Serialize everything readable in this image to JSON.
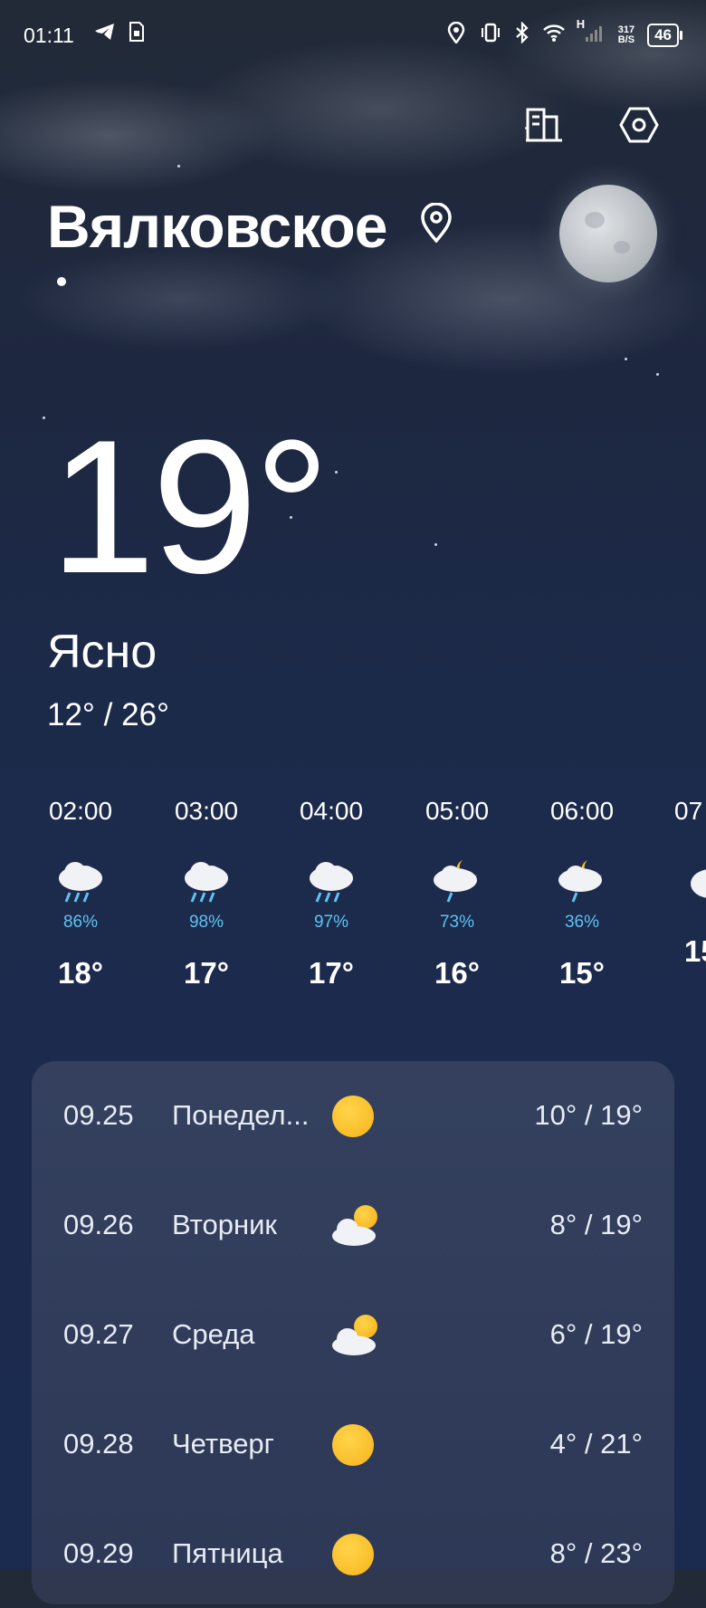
{
  "status_bar": {
    "time": "01:11",
    "net_speed_top": "317",
    "net_speed_bottom": "B/S",
    "network_label": "H",
    "battery": "46"
  },
  "location": {
    "city": "Вялковское",
    "current_temp": "19°",
    "condition": "Ясно",
    "range": "12° / 26°"
  },
  "hourly": [
    {
      "time": "02:00",
      "icon": "rain-cloud-icon",
      "precip": "86%",
      "temp": "18°"
    },
    {
      "time": "03:00",
      "icon": "rain-cloud-icon",
      "precip": "98%",
      "temp": "17°"
    },
    {
      "time": "04:00",
      "icon": "rain-cloud-icon",
      "precip": "97%",
      "temp": "17°"
    },
    {
      "time": "05:00",
      "icon": "moon-rain-cloud-icon",
      "precip": "73%",
      "temp": "16°"
    },
    {
      "time": "06:00",
      "icon": "moon-rain-cloud-icon",
      "precip": "36%",
      "temp": "15°"
    },
    {
      "time": "07",
      "icon": "cloud-icon",
      "precip": "",
      "temp": "15"
    }
  ],
  "daily": [
    {
      "date": "09.25",
      "day": "Понедел...",
      "icon": "sun-icon",
      "range": "10° / 19°"
    },
    {
      "date": "09.26",
      "day": "Вторник",
      "icon": "partly-cloudy-icon",
      "range": "8° / 19°"
    },
    {
      "date": "09.27",
      "day": "Среда",
      "icon": "partly-cloudy-icon",
      "range": "6° / 19°"
    },
    {
      "date": "09.28",
      "day": "Четверг",
      "icon": "sun-icon",
      "range": "4° / 21°"
    },
    {
      "date": "09.29",
      "day": "Пятница",
      "icon": "sun-icon",
      "range": "8° / 23°"
    }
  ],
  "colors": {
    "precip": "#5fc3f3",
    "sun": "#f7b31c"
  }
}
